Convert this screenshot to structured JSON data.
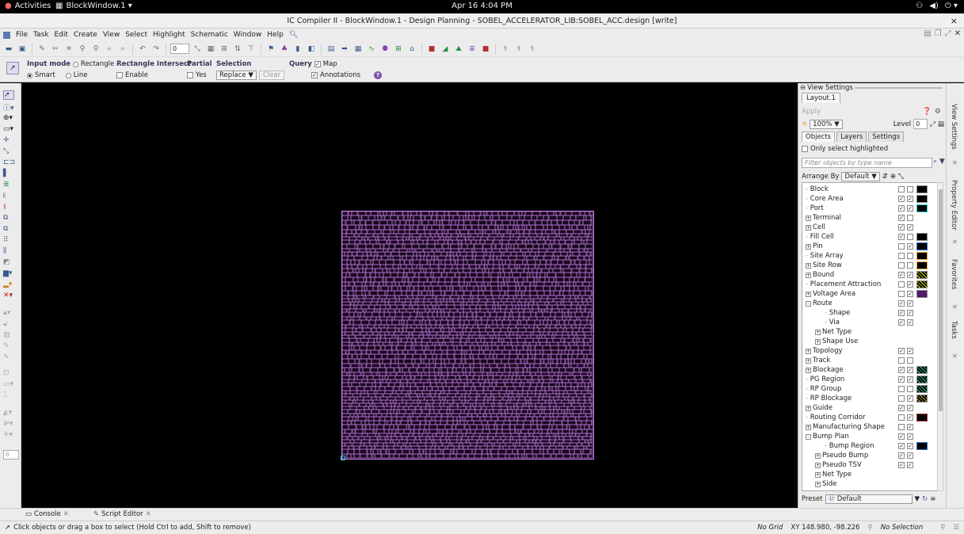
{
  "topbar": {
    "activities": "Activities",
    "window_name": "BlockWindow.1 ▾",
    "clock": "Apr 16  4:04 PM",
    "tray": [
      "network-icon",
      "volume-icon",
      "power-icon"
    ]
  },
  "titlebar": {
    "title": "IC Compiler II - BlockWindow.1 - Design Planning - SOBEL_ACCELERATOR_LIB:SOBEL_ACC.design [write]",
    "close": "×"
  },
  "menu": {
    "items": [
      "File",
      "Task",
      "Edit",
      "Create",
      "View",
      "Select",
      "Highlight",
      "Schematic",
      "Window",
      "Help"
    ]
  },
  "toolbar": {
    "spin_value": "0"
  },
  "options": {
    "input_mode_label": "Input mode",
    "rect_label": "Rectangle",
    "smart_label": "Smart",
    "line_label": "Line",
    "rect_intersect_label": "Rectangle Intersect",
    "enable_label": "Enable",
    "partial_label": "Partial",
    "yes_label": "Yes",
    "selection_label": "Selection",
    "selection_value": "Replace",
    "clear_label": "Clear",
    "query_label": "Query",
    "map_label": "Map",
    "annotations_label": "Annotations"
  },
  "left_tools": {
    "value_box": "0"
  },
  "canvas": {
    "layout_color": "#c77fe6",
    "background": "#000000"
  },
  "panel": {
    "header": "View Settings",
    "tab": "Layout.1",
    "apply": "Apply",
    "zoom": "100%",
    "level_label": "Level",
    "level_value": "0",
    "subtabs": [
      "Objects",
      "Layers",
      "Settings"
    ],
    "only_select": "Only select highlighted",
    "filter_placeholder": "Filter objects by type name",
    "arrange_label": "Arrange By",
    "arrange_value": "Default",
    "preset_label": "Preset",
    "preset_value": "Default",
    "tree": [
      {
        "label": "Block",
        "indent": 0,
        "exp": "",
        "c1": false,
        "c2": false,
        "sw": "plain"
      },
      {
        "label": "Core Area",
        "indent": 0,
        "exp": "",
        "c1": true,
        "c2": true,
        "sw": "plain"
      },
      {
        "label": "Port",
        "indent": 0,
        "exp": "",
        "c1": true,
        "c2": true,
        "sw": "teal"
      },
      {
        "label": "Terminal",
        "indent": 0,
        "exp": "+",
        "c1": true,
        "c2": false,
        "sw": ""
      },
      {
        "label": "Cell",
        "indent": 0,
        "exp": "+",
        "c1": true,
        "c2": true,
        "sw": ""
      },
      {
        "label": "Fill Cell",
        "indent": 0,
        "exp": "",
        "c1": true,
        "c2": false,
        "sw": "plain"
      },
      {
        "label": "Pin",
        "indent": 0,
        "exp": "+",
        "c1": false,
        "c2": true,
        "sw": "blue"
      },
      {
        "label": "Site Array",
        "indent": 0,
        "exp": "",
        "c1": false,
        "c2": false,
        "sw": "orange"
      },
      {
        "label": "Site Row",
        "indent": 0,
        "exp": "+",
        "c1": false,
        "c2": false,
        "sw": "orange"
      },
      {
        "label": "Bound",
        "indent": 0,
        "exp": "+",
        "c1": true,
        "c2": true,
        "sw": "dots"
      },
      {
        "label": "Placement Attraction",
        "indent": 0,
        "exp": "",
        "c1": false,
        "c2": true,
        "sw": "dots"
      },
      {
        "label": "Voltage Area",
        "indent": 0,
        "exp": "+",
        "c1": false,
        "c2": true,
        "sw": "purp"
      },
      {
        "label": "Route",
        "indent": 0,
        "exp": "-",
        "c1": true,
        "c2": true,
        "sw": ""
      },
      {
        "label": "Shape",
        "indent": 2,
        "exp": "",
        "c1": true,
        "c2": true,
        "sw": ""
      },
      {
        "label": "Via",
        "indent": 2,
        "exp": "",
        "c1": true,
        "c2": true,
        "sw": ""
      },
      {
        "label": "Net Type",
        "indent": 1,
        "exp": "+",
        "c1": null,
        "c2": null,
        "sw": ""
      },
      {
        "label": "Shape Use",
        "indent": 1,
        "exp": "+",
        "c1": null,
        "c2": null,
        "sw": ""
      },
      {
        "label": "Topology",
        "indent": 0,
        "exp": "+",
        "c1": true,
        "c2": true,
        "sw": ""
      },
      {
        "label": "Track",
        "indent": 0,
        "exp": "+",
        "c1": false,
        "c2": false,
        "sw": ""
      },
      {
        "label": "Blockage",
        "indent": 0,
        "exp": "+",
        "c1": true,
        "c2": true,
        "sw": "dotsg"
      },
      {
        "label": "PG Region",
        "indent": 0,
        "exp": "",
        "c1": true,
        "c2": true,
        "sw": "dotsg"
      },
      {
        "label": "RP Group",
        "indent": 0,
        "exp": "",
        "c1": false,
        "c2": false,
        "sw": "dotsg"
      },
      {
        "label": "RP Blockage",
        "indent": 0,
        "exp": "",
        "c1": false,
        "c2": true,
        "sw": "stripe"
      },
      {
        "label": "Guide",
        "indent": 0,
        "exp": "+",
        "c1": true,
        "c2": true,
        "sw": ""
      },
      {
        "label": "Routing Corridor",
        "indent": 0,
        "exp": "",
        "c1": false,
        "c2": true,
        "sw": "redb"
      },
      {
        "label": "Manufacturing Shape",
        "indent": 0,
        "exp": "+",
        "c1": false,
        "c2": true,
        "sw": ""
      },
      {
        "label": "Bump Plan",
        "indent": 0,
        "exp": "-",
        "c1": true,
        "c2": true,
        "sw": ""
      },
      {
        "label": "Bump Region",
        "indent": 2,
        "exp": "",
        "c1": true,
        "c2": true,
        "sw": "blue"
      },
      {
        "label": "Pseudo Bump",
        "indent": 1,
        "exp": "+",
        "c1": true,
        "c2": true,
        "sw": ""
      },
      {
        "label": "Pseudo TSV",
        "indent": 1,
        "exp": "+",
        "c1": true,
        "c2": true,
        "sw": ""
      },
      {
        "label": "Net Type",
        "indent": 1,
        "exp": "+",
        "c1": null,
        "c2": null,
        "sw": ""
      },
      {
        "label": "Side",
        "indent": 1,
        "exp": "+",
        "c1": null,
        "c2": null,
        "sw": ""
      }
    ]
  },
  "sidetabs": [
    "View Settings",
    "Property Editor",
    "Favorites",
    "Tasks"
  ],
  "bottom_tabs": {
    "console": "Console",
    "script": "Script Editor"
  },
  "status": {
    "hint": "Click objects or drag a box to select (Hold Ctrl to add, Shift to remove)",
    "grid": "No Grid",
    "xy": "XY 148.980, -98.226",
    "selection": "No Selection"
  }
}
